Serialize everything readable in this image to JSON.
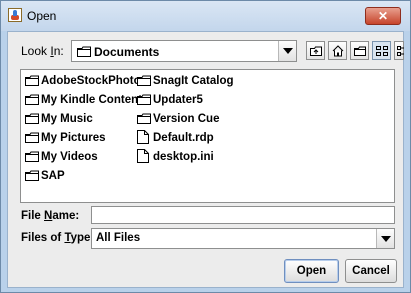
{
  "window": {
    "title": "Open",
    "close_glyph": "✕"
  },
  "look_in": {
    "label_prefix": "Look ",
    "label_mnemonic": "I",
    "label_suffix": "n:",
    "value": "Documents"
  },
  "toolbar": {
    "buttons": [
      "up-one-level",
      "home",
      "new-folder",
      "list-view",
      "details-view"
    ],
    "active": "list-view"
  },
  "files": {
    "column1": [
      {
        "name": "AdobeStockPhotos",
        "type": "folder"
      },
      {
        "name": "My Kindle Content",
        "type": "folder"
      },
      {
        "name": "My Music",
        "type": "folder"
      },
      {
        "name": "My Pictures",
        "type": "folder"
      },
      {
        "name": "My Videos",
        "type": "folder"
      },
      {
        "name": "SAP",
        "type": "folder"
      }
    ],
    "column2": [
      {
        "name": "SnagIt Catalog",
        "type": "folder"
      },
      {
        "name": "Updater5",
        "type": "folder"
      },
      {
        "name": "Version Cue",
        "type": "folder"
      },
      {
        "name": "Default.rdp",
        "type": "file"
      },
      {
        "name": "desktop.ini",
        "type": "file"
      }
    ]
  },
  "file_name": {
    "label_prefix": "File ",
    "label_mnemonic": "N",
    "label_suffix": "ame:",
    "value": ""
  },
  "file_type": {
    "label_prefix": "Files of ",
    "label_mnemonic": "T",
    "label_suffix": "ype:",
    "value": "All Files"
  },
  "buttons": {
    "open": "Open",
    "cancel": "Cancel"
  }
}
